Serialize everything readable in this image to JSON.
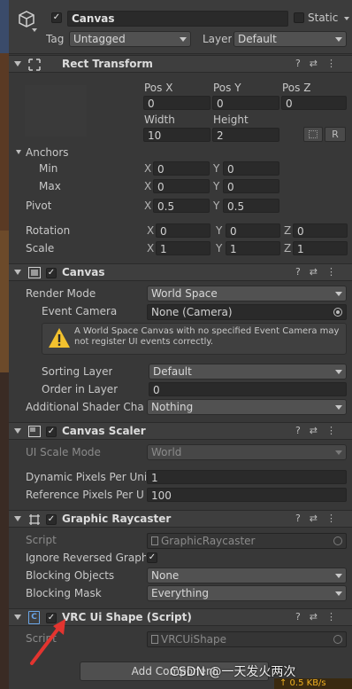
{
  "gameobject": {
    "name": "Canvas",
    "static_label": "Static",
    "tag_label": "Tag",
    "tag_value": "Untagged",
    "layer_label": "Layer",
    "layer_value": "Default"
  },
  "rect_transform": {
    "title": "Rect Transform",
    "pos_x_label": "Pos X",
    "pos_y_label": "Pos Y",
    "pos_z_label": "Pos Z",
    "pos_x": "0",
    "pos_y": "0",
    "pos_z": "0",
    "width_label": "Width",
    "height_label": "Height",
    "width": "10",
    "height": "2",
    "r_button": "R",
    "anchors_label": "Anchors",
    "min_label": "Min",
    "max_label": "Max",
    "min_x": "0",
    "min_y": "0",
    "max_x": "0",
    "max_y": "0",
    "pivot_label": "Pivot",
    "pivot_x": "0.5",
    "pivot_y": "0.5",
    "rotation_label": "Rotation",
    "rot_x": "0",
    "rot_y": "0",
    "rot_z": "0",
    "scale_label": "Scale",
    "scale_x": "1",
    "scale_y": "1",
    "scale_z": "1",
    "x": "X",
    "y": "Y",
    "z": "Z"
  },
  "canvas": {
    "title": "Canvas",
    "render_mode_label": "Render Mode",
    "render_mode": "World Space",
    "event_camera_label": "Event Camera",
    "event_camera": "None (Camera)",
    "warning": "A World Space Canvas with no specified Event Camera may not register UI events correctly.",
    "sorting_layer_label": "Sorting Layer",
    "sorting_layer": "Default",
    "order_in_layer_label": "Order in Layer",
    "order_in_layer": "0",
    "additional_shader_label": "Additional Shader Chann",
    "additional_shader": "Nothing"
  },
  "canvas_scaler": {
    "title": "Canvas Scaler",
    "ui_scale_mode_label": "UI Scale Mode",
    "ui_scale_mode": "World",
    "dynamic_ppu_label": "Dynamic Pixels Per Unit",
    "dynamic_ppu": "1",
    "reference_ppu_label": "Reference Pixels Per Un",
    "reference_ppu": "100"
  },
  "graphic_raycaster": {
    "title": "Graphic Raycaster",
    "script_label": "Script",
    "script": "GraphicRaycaster",
    "ignore_reversed_label": "Ignore Reversed Graphic",
    "blocking_objects_label": "Blocking Objects",
    "blocking_objects": "None",
    "blocking_mask_label": "Blocking Mask",
    "blocking_mask": "Everything"
  },
  "vrc_ui_shape": {
    "title": "VRC Ui Shape (Script)",
    "script_label": "Script",
    "script": "VRCUiShape"
  },
  "add_component": "Add Component",
  "watermark": "CSDN @一天发火两次",
  "net_speed": "↑ 0.5 KB/s",
  "colors": {
    "background": "#383838",
    "header": "#3e3e3e",
    "field": "#2a2a2a",
    "warning_yellow": "#f2c12e",
    "annotation_red": "#e3342f"
  }
}
